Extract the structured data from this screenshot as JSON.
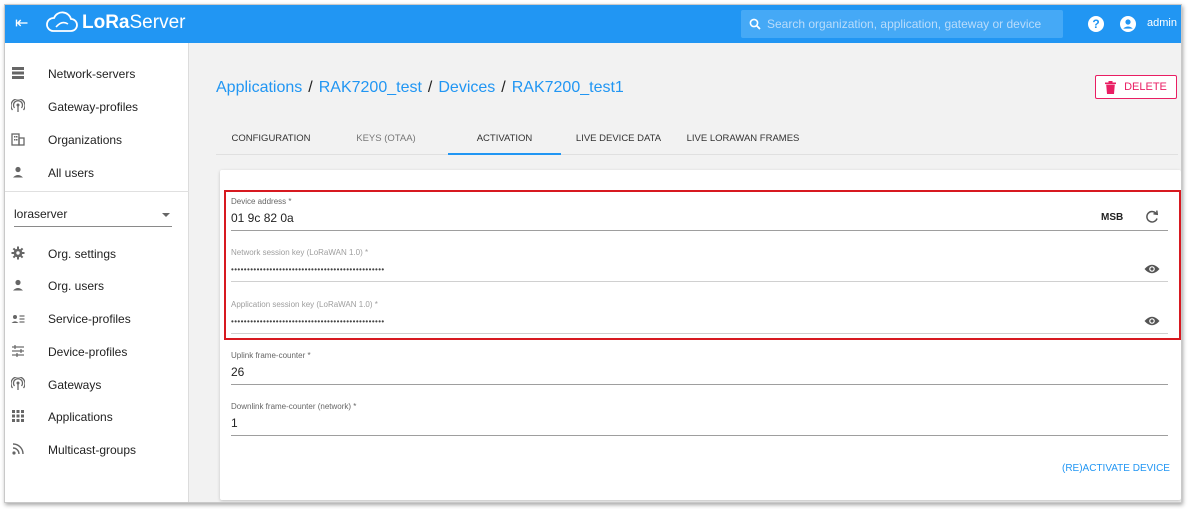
{
  "app": {
    "brand_bold": "LoRa",
    "brand_regular": "Server"
  },
  "search": {
    "placeholder": "Search organization, application, gateway or device"
  },
  "user": {
    "name": "admin"
  },
  "sidebar": {
    "global_items": [
      {
        "label": "Network-servers",
        "icon": "server-icon"
      },
      {
        "label": "Gateway-profiles",
        "icon": "antenna-icon"
      },
      {
        "label": "Organizations",
        "icon": "building-icon"
      },
      {
        "label": "All users",
        "icon": "person-icon"
      }
    ],
    "org_select": {
      "value": "loraserver"
    },
    "org_items": [
      {
        "label": "Org. settings",
        "icon": "gear-icon"
      },
      {
        "label": "Org. users",
        "icon": "person-icon"
      },
      {
        "label": "Service-profiles",
        "icon": "person-list-icon"
      },
      {
        "label": "Device-profiles",
        "icon": "sliders-icon"
      },
      {
        "label": "Gateways",
        "icon": "antenna-icon"
      },
      {
        "label": "Applications",
        "icon": "grid-icon"
      },
      {
        "label": "Multicast-groups",
        "icon": "rss-icon"
      }
    ]
  },
  "breadcrumb": {
    "items": [
      "Applications",
      "RAK7200_test",
      "Devices",
      "RAK7200_test1"
    ],
    "separator": "/"
  },
  "actions": {
    "delete_label": "DELETE"
  },
  "tabs": [
    {
      "label": "Configuration",
      "active": false
    },
    {
      "label": "Keys (OTAA)",
      "active": false,
      "muted": true
    },
    {
      "label": "Activation",
      "active": true
    },
    {
      "label": "Live device data",
      "active": false
    },
    {
      "label": "Live LoRaWAN frames",
      "active": false
    }
  ],
  "form": {
    "device_address": {
      "label": "Device address *",
      "value": "01 9c 82 0a",
      "byte_order": "MSB"
    },
    "network_session_key": {
      "label": "Network session key (LoRaWAN 1.0) *",
      "value": "••••••••••••••••••••••••••••••••••••••••••••••••"
    },
    "app_session_key": {
      "label": "Application session key (LoRaWAN 1.0) *",
      "value": "••••••••••••••••••••••••••••••••••••••••••••••••"
    },
    "uplink_counter": {
      "label": "Uplink frame-counter *",
      "value": "26"
    },
    "downlink_counter": {
      "label": "Downlink frame-counter (network) *",
      "value": "1"
    },
    "submit_label": "(Re)activate device"
  },
  "colors": {
    "primary": "#2196f3",
    "danger": "#e91e63",
    "highlight": "#d71920"
  }
}
